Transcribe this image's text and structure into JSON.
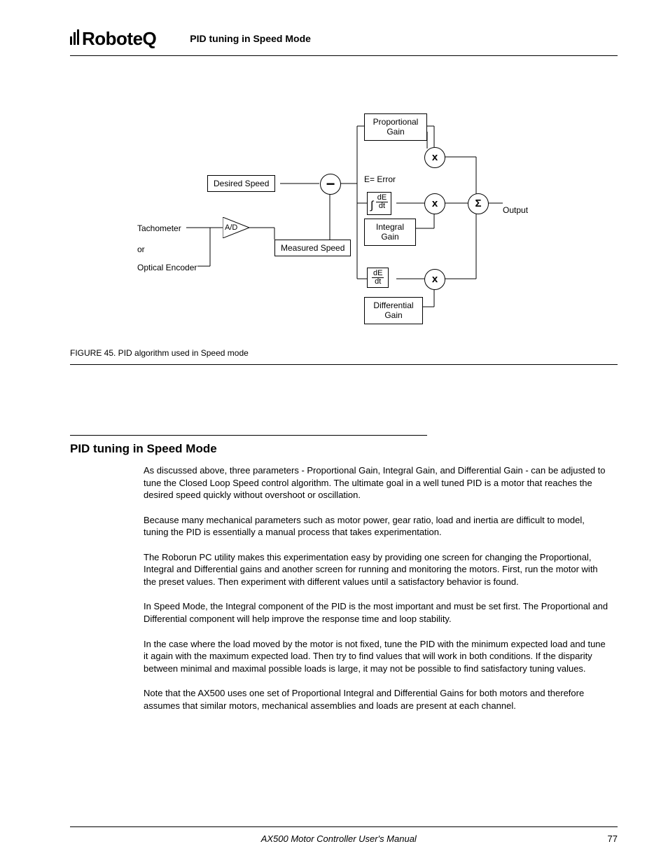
{
  "brand": "RoboteQ",
  "header_title": "PID tuning in Speed Mode",
  "figure": {
    "caption": "FIGURE 45.  PID algorithm used in Speed mode",
    "boxes": {
      "desired_speed": "Desired Speed",
      "measured_speed": "Measured Speed",
      "proportional_gain": "Proportional\nGain",
      "integral_gain": "Integral\nGain",
      "differential_gain": "Differential\nGain",
      "integral_block_top": "dE",
      "integral_block_bot": "dt",
      "deriv_block_top": "dE",
      "deriv_block_bot": "dt"
    },
    "labels": {
      "tachometer": "Tachometer",
      "or": "or",
      "optical_encoder": "Optical Encoder",
      "ad": "A/D",
      "error": "E= Error",
      "output": "Output"
    },
    "ops": {
      "minus": "−",
      "mult": "x",
      "sum": "Σ",
      "integral_sym": "∫"
    }
  },
  "section_heading": "PID tuning in Speed Mode",
  "paragraphs": [
    "As discussed above, three parameters - Proportional Gain, Integral Gain, and Differential Gain - can be adjusted to tune the Closed Loop Speed control algorithm. The ultimate goal in a well tuned PID is a motor that reaches the desired speed quickly without overshoot or oscillation.",
    "Because many mechanical parameters such as motor power, gear ratio, load and inertia are difficult to model, tuning the PID is essentially a manual process that takes experimentation.",
    "The Roborun PC utility makes this experimentation easy by providing one screen for changing the Proportional, Integral and Differential gains and another screen for running and monitoring the motors. First, run the motor with the preset values. Then experiment with different values until a satisfactory behavior is found.",
    "In Speed Mode, the Integral component of the PID is the most important and must be set first. The Proportional and Differential component will help improve the response time and loop stability.",
    "In the case where the load moved by the motor is not fixed, tune the PID with the minimum expected load and tune it again with the maximum expected load. Then try to find values that will work in both conditions. If the disparity between minimal and maximal possible loads is large, it may not be possible to find satisfactory tuning values.",
    "Note that the AX500 uses one set of Proportional Integral and Differential Gains for both motors and therefore assumes that similar motors, mechanical assemblies and loads are present at each channel."
  ],
  "footer": {
    "doc": "AX500 Motor Controller User's Manual",
    "page": "77"
  }
}
